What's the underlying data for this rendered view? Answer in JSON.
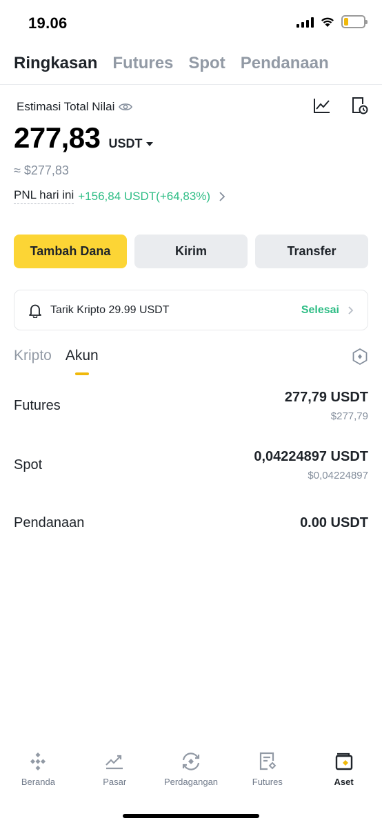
{
  "status_bar": {
    "time": "19.06"
  },
  "top_tabs": [
    {
      "label": "Ringkasan",
      "active": true
    },
    {
      "label": "Futures",
      "active": false
    },
    {
      "label": "Spot",
      "active": false
    },
    {
      "label": "Pendanaan",
      "active": false
    }
  ],
  "summary": {
    "estimate_label": "Estimasi Total Nilai",
    "total_value": "277,83",
    "currency": "USDT",
    "approx_fiat": "≈ $277,83",
    "pnl_label": "PNL hari ini",
    "pnl_value": "+156,84 USDT(+64,83%)"
  },
  "actions": {
    "deposit": "Tambah Dana",
    "send": "Kirim",
    "transfer": "Transfer"
  },
  "notice": {
    "text": "Tarik Kripto 29.99 USDT",
    "status": "Selesai"
  },
  "sub_tabs": [
    {
      "label": "Kripto",
      "active": false
    },
    {
      "label": "Akun",
      "active": true
    }
  ],
  "accounts": [
    {
      "name": "Futures",
      "amount": "277,79 USDT",
      "fiat": "$277,79"
    },
    {
      "name": "Spot",
      "amount": "0,04224897 USDT",
      "fiat": "$0,04224897"
    },
    {
      "name": "Pendanaan",
      "amount": "0.00 USDT",
      "fiat": ""
    }
  ],
  "bottom_nav": [
    {
      "label": "Beranda",
      "icon": "binance-logo-icon",
      "active": false
    },
    {
      "label": "Pasar",
      "icon": "market-chart-icon",
      "active": false
    },
    {
      "label": "Perdagangan",
      "icon": "trade-swap-icon",
      "active": false
    },
    {
      "label": "Futures",
      "icon": "futures-document-icon",
      "active": false
    },
    {
      "label": "Aset",
      "icon": "wallet-icon",
      "active": true
    }
  ],
  "colors": {
    "accent_yellow": "#fcd535",
    "positive_green": "#2ebd85",
    "text_primary": "#1e2329",
    "text_secondary": "#848e9c"
  }
}
